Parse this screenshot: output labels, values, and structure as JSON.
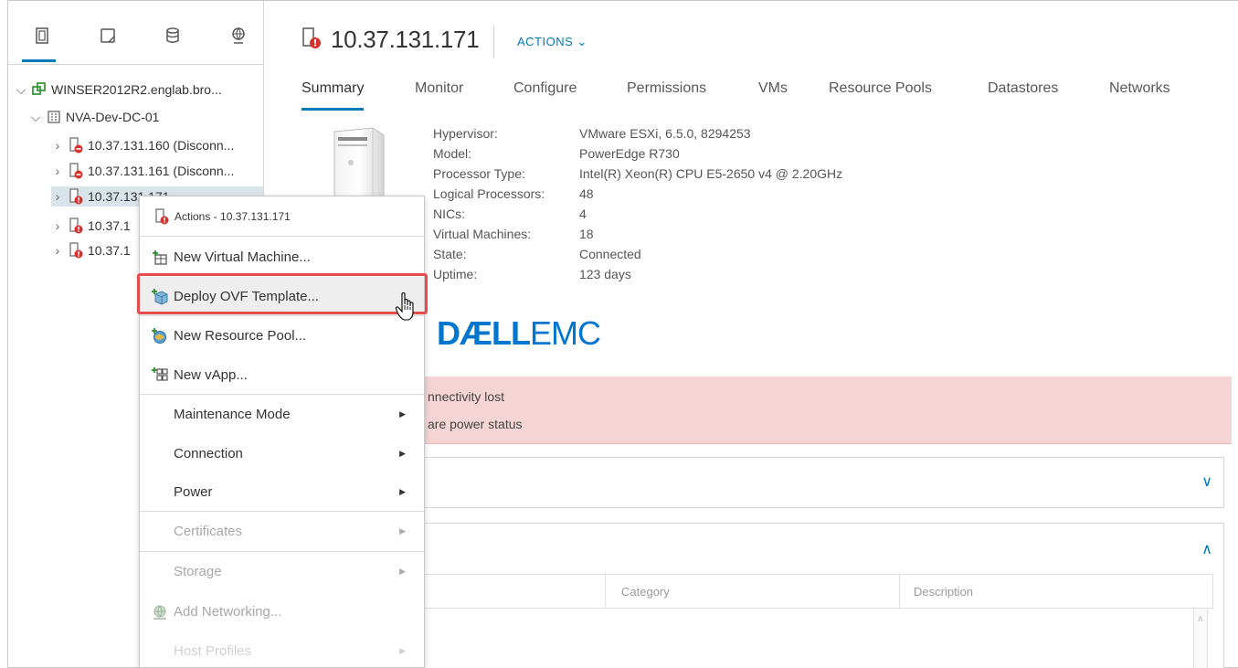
{
  "navigator": {
    "tabs": [
      {
        "icon": "hosts-clusters-icon"
      },
      {
        "icon": "vms-templates-icon"
      },
      {
        "icon": "storage-icon"
      },
      {
        "icon": "networking-icon"
      }
    ],
    "tree": [
      {
        "label": "WINSER2012R2.englab.bro...",
        "icon": "vcenter-icon",
        "expanded": true
      },
      {
        "label": "NVA-Dev-DC-01",
        "icon": "datacenter-icon",
        "expanded": true
      },
      {
        "label": "10.37.131.160 (Disconn...",
        "icon": "host-disconnected-icon"
      },
      {
        "label": "10.37.131.161 (Disconn...",
        "icon": "host-disconnected-icon"
      },
      {
        "label": "10.37.131.171",
        "icon": "host-alert-icon",
        "selected": true
      },
      {
        "label": "10.37.1",
        "icon": "host-alert-icon"
      },
      {
        "label": "10.37.1",
        "icon": "host-alert-icon"
      }
    ]
  },
  "header": {
    "host_name": "10.37.131.171",
    "actions_label": "ACTIONS ⌄"
  },
  "tabs": [
    "Summary",
    "Monitor",
    "Configure",
    "Permissions",
    "VMs",
    "Resource Pools",
    "Datastores",
    "Networks"
  ],
  "summary": {
    "properties": [
      {
        "label": "Hypervisor:",
        "value": "VMware ESXi, 6.5.0, 8294253"
      },
      {
        "label": "Model:",
        "value": "PowerEdge R730"
      },
      {
        "label": "Processor Type:",
        "value": "Intel(R) Xeon(R) CPU E5-2650 v4 @ 2.20GHz"
      },
      {
        "label": "Logical Processors:",
        "value": "48"
      },
      {
        "label": "NICs:",
        "value": "4"
      },
      {
        "label": "Virtual Machines:",
        "value": "18"
      },
      {
        "label": "State:",
        "value": "Connected"
      },
      {
        "label": "Uptime:",
        "value": "123 days"
      }
    ],
    "vendor_logo": {
      "dell": "DÆLL",
      "emc": "EMC"
    },
    "alerts": [
      "nnectivity lost",
      "are power status"
    ],
    "table_headers": {
      "category": "Category",
      "description": "Description"
    }
  },
  "context_menu": {
    "title": "Actions - 10.37.131.171",
    "items": [
      {
        "label": "New Virtual Machine...",
        "icon": "new-vm-icon"
      },
      {
        "label": "Deploy OVF Template...",
        "icon": "deploy-ovf-icon",
        "highlighted": true
      },
      {
        "label": "New Resource Pool...",
        "icon": "resource-pool-icon"
      },
      {
        "label": "New vApp...",
        "icon": "vapp-icon"
      },
      {
        "label": "Maintenance Mode",
        "submenu": true
      },
      {
        "label": "Connection",
        "submenu": true
      },
      {
        "label": "Power",
        "submenu": true
      },
      {
        "label": "Certificates",
        "submenu": true,
        "disabled": true
      },
      {
        "label": "Storage",
        "submenu": true,
        "disabled": true
      },
      {
        "label": "Add Networking...",
        "icon": "add-networking-icon",
        "disabled": true
      },
      {
        "label": "Host Profiles",
        "submenu": true,
        "disabled": true
      }
    ]
  },
  "colors": {
    "accent": "#0079b8",
    "alert_bg": "#f4d4d4",
    "highlight_border": "#e74c4c",
    "dell_blue": "#0076ce"
  }
}
